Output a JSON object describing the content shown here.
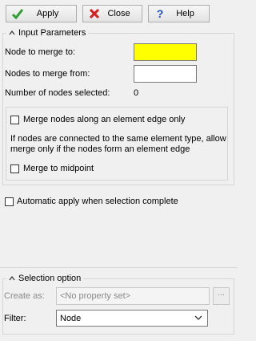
{
  "toolbar": {
    "apply_label": "Apply",
    "close_label": "Close",
    "help_label": "Help",
    "help_glyph": "?"
  },
  "input_parameters": {
    "title": "Input Parameters",
    "node_to_merge_to_label": "Node to merge to:",
    "node_to_merge_to_value": "",
    "node_to_merge_to_color": "#ffff00",
    "nodes_to_merge_from_label": "Nodes to merge from:",
    "nodes_to_merge_from_value": "",
    "number_selected_label": "Number of nodes selected:",
    "number_selected_value": "0",
    "merge_along_edge_label": "Merge nodes along an element edge only",
    "merge_along_edge_checked": false,
    "info_text_line1": "If nodes are connected to the same element type, allow",
    "info_text_line2": "merge only if the nodes form an element edge",
    "merge_to_midpoint_label": "Merge to midpoint",
    "merge_to_midpoint_checked": false
  },
  "auto_apply": {
    "label": "Automatic apply when selection complete",
    "checked": false
  },
  "selection_option": {
    "title": "Selection option",
    "create_as_label": "Create as:",
    "create_as_placeholder": "<No property set>",
    "browse_label": "...",
    "filter_label": "Filter:",
    "filter_value": "Node"
  },
  "colors": {
    "apply_check": "#2e9e2e",
    "close_x": "#d42020",
    "help_blue": "#1c4fc2"
  }
}
